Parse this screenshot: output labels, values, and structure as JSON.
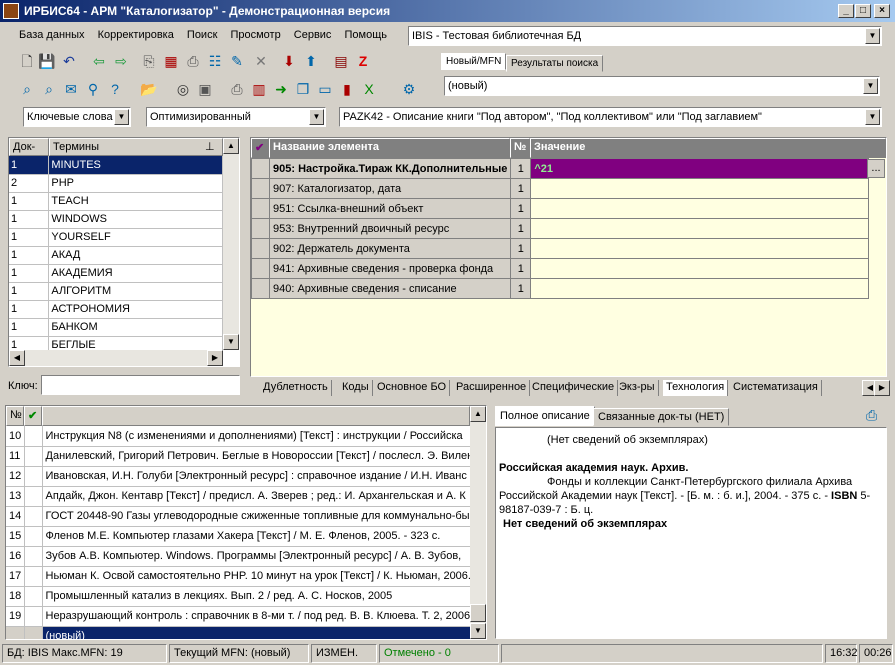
{
  "window": {
    "title": "ИРБИС64 - АРМ \"Каталогизатор\" - Демонстрационная версия"
  },
  "menu": [
    "База данных",
    "Корректировка",
    "Поиск",
    "Просмотр",
    "Сервис",
    "Помощь"
  ],
  "db_combo": "IBIS - Тестовая библиотечная БД",
  "record_tabs": [
    "Новый/MFN",
    "Результаты поиска"
  ],
  "record_combo": "(новый)",
  "search_mode": "Ключевые слова",
  "worksheet_mode": "Оптимизированный",
  "worksheet": "PAZK42 - Описание книги \"Под автором\", \"Под коллективом\" или \"Под заглавием\"",
  "terms": {
    "col_docs": "Док-ов",
    "col_terms": "Термины",
    "rows": [
      {
        "docs": "1",
        "term": "MINUTES"
      },
      {
        "docs": "2",
        "term": "PHP"
      },
      {
        "docs": "1",
        "term": "TEACH"
      },
      {
        "docs": "1",
        "term": "WINDOWS"
      },
      {
        "docs": "1",
        "term": "YOURSELF"
      },
      {
        "docs": "1",
        "term": "АКАД"
      },
      {
        "docs": "1",
        "term": "АКАДЕМИЯ"
      },
      {
        "docs": "1",
        "term": "АЛГОРИТМ"
      },
      {
        "docs": "1",
        "term": "АСТРОНОМИЯ"
      },
      {
        "docs": "1",
        "term": "БАНКОМ"
      },
      {
        "docs": "1",
        "term": "БЕГЛЫЕ"
      }
    ],
    "key_label": "Ключ:"
  },
  "elements": {
    "col_name": "Название элемента",
    "col_num": "№",
    "col_value": "Значение",
    "rows": [
      {
        "name": "905: Настройка.Тираж КК.Дополнительные",
        "num": "1",
        "value": "^21"
      },
      {
        "name": "907: Каталогизатор, дата",
        "num": "1",
        "value": ""
      },
      {
        "name": "951: Ссылка-внешний объект",
        "num": "1",
        "value": ""
      },
      {
        "name": "953: Внутренний двоичный ресурс",
        "num": "1",
        "value": ""
      },
      {
        "name": "902: Держатель документа",
        "num": "1",
        "value": ""
      },
      {
        "name": "941: Архивные сведения - проверка фонда",
        "num": "1",
        "value": ""
      },
      {
        "name": "940: Архивные сведения - списание",
        "num": "1",
        "value": ""
      }
    ],
    "ellipsis": "...",
    "tabs": [
      "Дублетность",
      "Коды",
      "Основное БО",
      "Расширенное",
      "Специфические",
      "Экз-ры",
      "Технология",
      "Систематизация"
    ]
  },
  "records": {
    "col_num": "№",
    "rows": [
      {
        "num": "10",
        "text": "Инструкция N8  (с изменениями и дополнениями) [Текст] : инструкции / Российска"
      },
      {
        "num": "11",
        "text": "Данилевский, Григорий Петрович. Беглые в Новороссии [Текст] / послесл. Э. Вилен"
      },
      {
        "num": "12",
        "text": "Ивановская, И.Н. Голуби [Электронный ресурс] : справочное издание / И.Н. Иванс"
      },
      {
        "num": "13",
        "text": "Апдайк, Джон. Кентавр [Текст] / предисл. А. Зверев ; ред.: И. Архангельская и А. К"
      },
      {
        "num": "14",
        "text": "ГОСТ 20448-90 Газы углеводородные сжиженные топливные для коммунально-бы"
      },
      {
        "num": "15",
        "text": "Фленов М.Е. Компьютер глазами Хакера [Текст] / М. Е. Фленов, 2005. - 323 с."
      },
      {
        "num": "16",
        "text": "Зубов А.В. Компьютер. Windows. Программы [Электронный ресурс] / А. В. Зубов, "
      },
      {
        "num": "17",
        "text": "Ньюман К. Освой самостоятельно PHP. 10 минут на урок [Текст] / К. Ньюман, 2006."
      },
      {
        "num": "18",
        "text": "Промышленный катализ в лекциях. Вып. 2 / ред. А. С. Носков, 2005"
      },
      {
        "num": "19",
        "text": "Неразрушающий контроль : справочник в 8-ми т. / под ред. В. В. Клюева. Т. 2, 2006."
      }
    ],
    "new_row": "(новый)"
  },
  "description": {
    "tabs": [
      "Полное описание",
      "Связанные док-ты (НЕТ)"
    ],
    "line1": "(Нет сведений об экземплярах)",
    "heading": "Российская академия наук. Архив.",
    "body_pre": "Фонды и коллекции Санкт-Петербургского филиала Архива Российской Академии наук [Текст]. - [Б. м. : б. и.], 2004. - 375 с. - ",
    "isbn_label": "ISBN",
    "body_post": " 5-98187-039-7 : Б. ц.",
    "line_last": "Нет сведений об экземплярах"
  },
  "status": {
    "db": "БД: IBIS Макс.MFN: 19",
    "current": "Текущий MFN: (новый)",
    "changed": "ИЗМЕН.",
    "marked": "Отмечено - 0",
    "time1": "16:32",
    "time2": "00:26"
  },
  "colors": {
    "title": "#0a246a",
    "selected": "#0a246a",
    "value_cell": "#800080",
    "worksheet_bg": "#ffffe1",
    "marked": "#008000"
  }
}
